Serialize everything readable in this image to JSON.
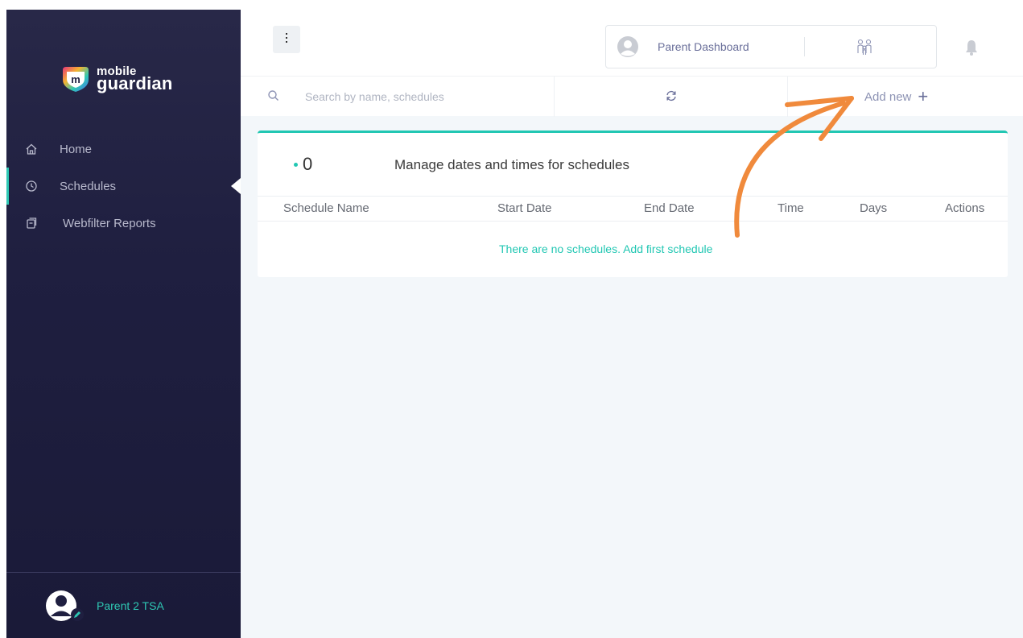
{
  "brand": {
    "name_top": "mobile",
    "name_bottom": "guardian",
    "logo_letter": "m",
    "accent_color": "#22c7b3",
    "sidebar_color": "#1f1f40"
  },
  "sidebar": {
    "items": [
      {
        "label": "Home",
        "icon": "home-icon",
        "active": false
      },
      {
        "label": "Schedules",
        "icon": "clock-icon",
        "active": true
      },
      {
        "label": "Webfilter Reports",
        "icon": "report-icon",
        "active": false
      }
    ],
    "user_name": "Parent 2 TSA"
  },
  "header": {
    "menu_icon": "vertical-dots-icon",
    "dashboard_label": "Parent Dashboard",
    "family_icon": "family-icon",
    "bell_icon": "bell-icon"
  },
  "toolbar": {
    "search_placeholder": "Search by name, schedules",
    "refresh_icon": "refresh-icon",
    "add_new_label": "Add new",
    "add_new_icon": "+"
  },
  "schedules_card": {
    "count": "0",
    "title": "Manage dates and times for schedules",
    "columns": [
      "Schedule Name",
      "Start Date",
      "End Date",
      "Time",
      "Days",
      "Actions"
    ],
    "empty_message": "There are no schedules. Add first schedule"
  },
  "annotation": {
    "arrow_color": "#f08a3c",
    "points_to": "add-new-button"
  }
}
